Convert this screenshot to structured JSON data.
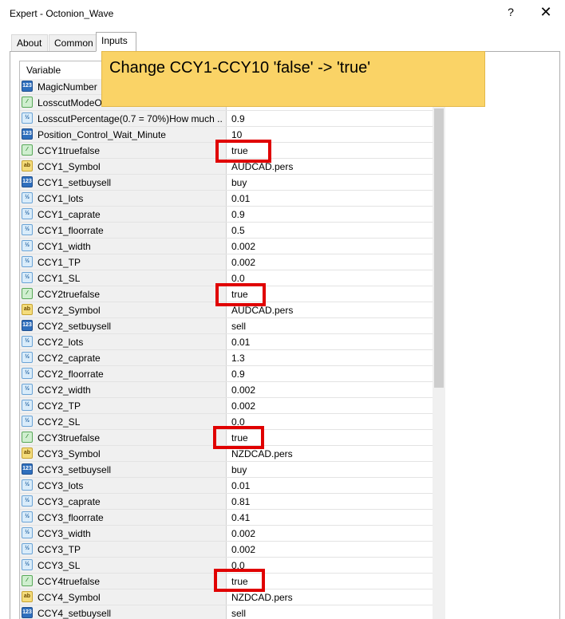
{
  "window": {
    "title": "Expert - Octonion_Wave",
    "help_label": "?",
    "close_label": "✕"
  },
  "tabs": [
    {
      "label": "About"
    },
    {
      "label": "Common"
    },
    {
      "label": "Inputs"
    }
  ],
  "grid": {
    "column_variable": "Variable"
  },
  "params": [
    {
      "icon": "123",
      "name": "MagicNumber",
      "value": ""
    },
    {
      "icon": "bool",
      "name": "LosscutModeO",
      "value": ""
    },
    {
      "icon": "v2",
      "name": "LosscutPercentage(0.7 = 70%)How much ...",
      "value": "0.9"
    },
    {
      "icon": "123",
      "name": "Position_Control_Wait_Minute",
      "value": "10"
    },
    {
      "icon": "bool",
      "name": "CCY1truefalse",
      "value": "true"
    },
    {
      "icon": "ab",
      "name": "CCY1_Symbol",
      "value": "AUDCAD.pers"
    },
    {
      "icon": "123",
      "name": "CCY1_setbuysell",
      "value": "buy"
    },
    {
      "icon": "v2",
      "name": "CCY1_lots",
      "value": "0.01"
    },
    {
      "icon": "v2",
      "name": "CCY1_caprate",
      "value": "0.9"
    },
    {
      "icon": "v2",
      "name": "CCY1_floorrate",
      "value": "0.5"
    },
    {
      "icon": "v2",
      "name": "CCY1_width",
      "value": "0.002"
    },
    {
      "icon": "v2",
      "name": "CCY1_TP",
      "value": "0.002"
    },
    {
      "icon": "v2",
      "name": "CCY1_SL",
      "value": "0.0"
    },
    {
      "icon": "bool",
      "name": "CCY2truefalse",
      "value": "true"
    },
    {
      "icon": "ab",
      "name": "CCY2_Symbol",
      "value": "AUDCAD.pers"
    },
    {
      "icon": "123",
      "name": "CCY2_setbuysell",
      "value": "sell"
    },
    {
      "icon": "v2",
      "name": "CCY2_lots",
      "value": "0.01"
    },
    {
      "icon": "v2",
      "name": "CCY2_caprate",
      "value": "1.3"
    },
    {
      "icon": "v2",
      "name": "CCY2_floorrate",
      "value": "0.9"
    },
    {
      "icon": "v2",
      "name": "CCY2_width",
      "value": "0.002"
    },
    {
      "icon": "v2",
      "name": "CCY2_TP",
      "value": "0.002"
    },
    {
      "icon": "v2",
      "name": "CCY2_SL",
      "value": "0.0"
    },
    {
      "icon": "bool",
      "name": "CCY3truefalse",
      "value": "true"
    },
    {
      "icon": "ab",
      "name": "CCY3_Symbol",
      "value": "NZDCAD.pers"
    },
    {
      "icon": "123",
      "name": "CCY3_setbuysell",
      "value": "buy"
    },
    {
      "icon": "v2",
      "name": "CCY3_lots",
      "value": "0.01"
    },
    {
      "icon": "v2",
      "name": "CCY3_caprate",
      "value": "0.81"
    },
    {
      "icon": "v2",
      "name": "CCY3_floorrate",
      "value": "0.41"
    },
    {
      "icon": "v2",
      "name": "CCY3_width",
      "value": "0.002"
    },
    {
      "icon": "v2",
      "name": "CCY3_TP",
      "value": "0.002"
    },
    {
      "icon": "v2",
      "name": "CCY3_SL",
      "value": "0.0"
    },
    {
      "icon": "bool",
      "name": "CCY4truefalse",
      "value": "true"
    },
    {
      "icon": "ab",
      "name": "CCY4_Symbol",
      "value": "NZDCAD.pers"
    },
    {
      "icon": "123",
      "name": "CCY4_setbuysell",
      "value": "sell"
    }
  ],
  "icon_glyphs": {
    "123": "123",
    "v2": "½",
    "ab": "ab",
    "bool": "⁄"
  },
  "annotation": {
    "text": "Change CCY1-CCY10 'false' -> 'true'",
    "color": "#fad366",
    "highlight_color": "#e00000"
  }
}
